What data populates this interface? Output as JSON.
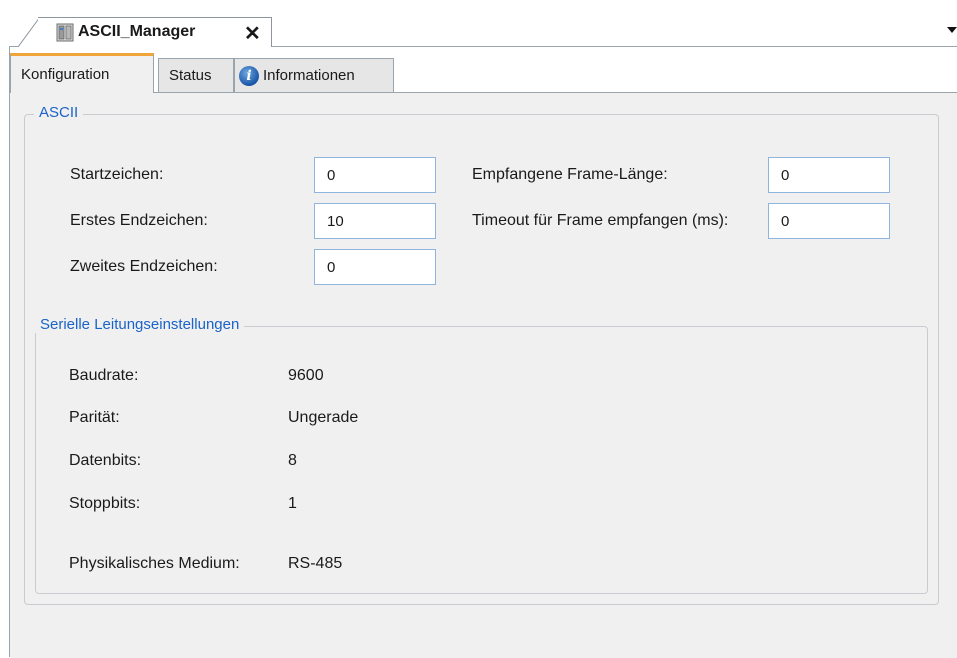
{
  "doc_tab": {
    "title": "ASCII_Manager",
    "close_glyph": "✕"
  },
  "tabs": [
    {
      "label": "Konfiguration"
    },
    {
      "label": "Status"
    },
    {
      "label": "Informationen"
    }
  ],
  "ascii": {
    "title": "ASCII",
    "left": [
      {
        "label": "Startzeichen:",
        "value": "0"
      },
      {
        "label": "Erstes Endzeichen:",
        "value": "10"
      },
      {
        "label": "Zweites Endzeichen:",
        "value": "0"
      }
    ],
    "right": [
      {
        "label": "Empfangene Frame-Länge:",
        "value": "0"
      },
      {
        "label": "Timeout für Frame empfangen (ms):",
        "value": "0"
      }
    ]
  },
  "serial": {
    "title": "Serielle Leitungseinstellungen",
    "rows": [
      {
        "label": "Baudrate:",
        "value": "9600"
      },
      {
        "label": "Parität:",
        "value": "Ungerade"
      },
      {
        "label": "Datenbits:",
        "value": "8"
      },
      {
        "label": "Stoppbits:",
        "value": "1"
      },
      {
        "label": "Physikalisches Medium:",
        "value": "RS-485"
      }
    ]
  },
  "colors": {
    "group_title": "#1a63c9",
    "active_tab_accent": "#f0a53a",
    "panel_bg": "#f0f0f0",
    "field_border": "#8fb4de"
  },
  "icons": {
    "doc_tab": "device-manager-icon",
    "info": "info-icon",
    "dropdown": "chevron-down-icon"
  }
}
